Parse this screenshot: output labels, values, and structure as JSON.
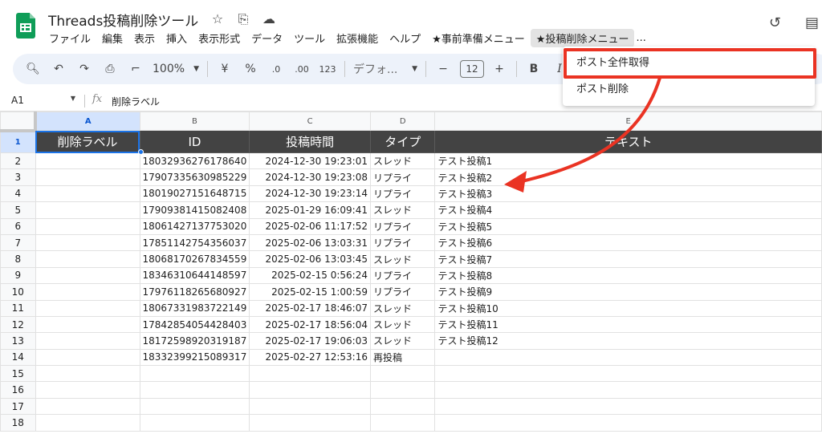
{
  "title_bar": {
    "doc_title": "Threads投稿削除ツール",
    "icons": [
      "star-icon",
      "move-to-folder-icon",
      "cloud-status-icon"
    ],
    "right_icons": [
      "history-icon",
      "comments-icon"
    ]
  },
  "menu": {
    "items": [
      "ファイル",
      "編集",
      "表示",
      "挿入",
      "表示形式",
      "データ",
      "ツール",
      "拡張機能",
      "ヘルプ",
      "★事前準備メニュー",
      "★投稿削除メニュー"
    ],
    "overflow": "..."
  },
  "toolbar": {
    "zoom": "100%",
    "currency": "¥",
    "percent": "%",
    "decrease_decimal": ".0",
    "increase_decimal": ".00",
    "number_format": "123",
    "font": "デフォ...",
    "font_size": "12",
    "minus": "−",
    "plus": "+",
    "bold": "B",
    "italic": "I"
  },
  "formula_bar": {
    "cell_ref": "A1",
    "fx": "fx",
    "content": "削除ラベル"
  },
  "grid": {
    "columns": [
      "A",
      "B",
      "C",
      "D",
      "E"
    ],
    "header_row": [
      "削除ラベル",
      "ID",
      "投稿時間",
      "タイプ",
      "テキスト"
    ],
    "rows": [
      {
        "num": "2",
        "label": "",
        "id": "18032936276178640",
        "time": "2024-12-30 19:23:01",
        "type": "スレッド",
        "text": "テスト投稿1"
      },
      {
        "num": "3",
        "label": "",
        "id": "17907335630985229",
        "time": "2024-12-30 19:23:08",
        "type": "リプライ",
        "text": "テスト投稿2"
      },
      {
        "num": "4",
        "label": "",
        "id": "18019027151648715",
        "time": "2024-12-30 19:23:14",
        "type": "リプライ",
        "text": "テスト投稿3"
      },
      {
        "num": "5",
        "label": "",
        "id": "17909381415082408",
        "time": "2025-01-29 16:09:41",
        "type": "スレッド",
        "text": "テスト投稿4"
      },
      {
        "num": "6",
        "label": "",
        "id": "18061427137753020",
        "time": "2025-02-06 11:17:52",
        "type": "リプライ",
        "text": "テスト投稿5"
      },
      {
        "num": "7",
        "label": "",
        "id": "17851142754356037",
        "time": "2025-02-06 13:03:31",
        "type": "リプライ",
        "text": "テスト投稿6"
      },
      {
        "num": "8",
        "label": "",
        "id": "18068170267834559",
        "time": "2025-02-06 13:03:45",
        "type": "スレッド",
        "text": "テスト投稿7"
      },
      {
        "num": "9",
        "label": "",
        "id": "18346310644148597",
        "time": "2025-02-15 0:56:24",
        "type": "リプライ",
        "text": "テスト投稿8"
      },
      {
        "num": "10",
        "label": "",
        "id": "17976118265680927",
        "time": "2025-02-15 1:00:59",
        "type": "リプライ",
        "text": "テスト投稿9"
      },
      {
        "num": "11",
        "label": "",
        "id": "18067331983722149",
        "time": "2025-02-17 18:46:07",
        "type": "スレッド",
        "text": "テスト投稿10"
      },
      {
        "num": "12",
        "label": "",
        "id": "17842854054428403",
        "time": "2025-02-17 18:56:04",
        "type": "スレッド",
        "text": "テスト投稿11"
      },
      {
        "num": "13",
        "label": "",
        "id": "18172598920319187",
        "time": "2025-02-17 19:06:03",
        "type": "スレッド",
        "text": "テスト投稿12"
      },
      {
        "num": "14",
        "label": "",
        "id": "18332399215089317",
        "time": "2025-02-27 12:53:16",
        "type": "再投稿",
        "text": ""
      },
      {
        "num": "15",
        "label": "",
        "id": "",
        "time": "",
        "type": "",
        "text": ""
      },
      {
        "num": "16",
        "label": "",
        "id": "",
        "time": "",
        "type": "",
        "text": ""
      },
      {
        "num": "17",
        "label": "",
        "id": "",
        "time": "",
        "type": "",
        "text": ""
      },
      {
        "num": "18",
        "label": "",
        "id": "",
        "time": "",
        "type": "",
        "text": ""
      }
    ]
  },
  "dropdown": {
    "items": [
      "ポスト全件取得",
      "ポスト削除"
    ],
    "highlight_color": "#ea3323"
  },
  "colors": {
    "accent": "#1a73e8",
    "header_bg": "#434343",
    "sheets_green": "#0f9d58",
    "annotation_red": "#ea3323"
  }
}
